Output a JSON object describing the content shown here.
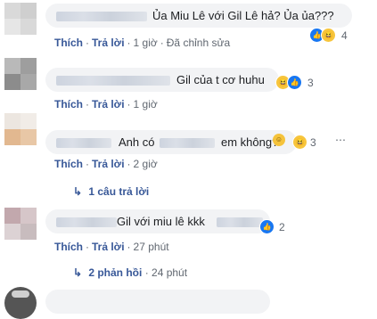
{
  "comments": [
    {
      "text": "Ủa Miu Lê với Gil Lê hả? Ủa ủa???",
      "reaction_count": "4",
      "actions": {
        "like": "Thích",
        "reply": "Trả lời",
        "time": "1 giờ",
        "edited": "Đã chỉnh sửa"
      }
    },
    {
      "text": "Gil của t cơ huhu",
      "reaction_count": "3",
      "actions": {
        "like": "Thích",
        "reply": "Trả lời",
        "time": "1 giờ"
      }
    },
    {
      "text_before": "Anh có",
      "text_after": "em không?",
      "reaction_count": "3",
      "actions": {
        "like": "Thích",
        "reply": "Trả lời",
        "time": "2 giờ"
      },
      "replies_label": "1 câu trả lời"
    },
    {
      "text": "Gil với miu lê kkk",
      "reaction_count": "2",
      "actions": {
        "like": "Thích",
        "reply": "Trả lời",
        "time": "27 phút"
      },
      "replies_label": "2 phản hồi",
      "replies_time": "24 phút"
    }
  ],
  "separator": "·",
  "icons": {
    "like": "like-icon",
    "haha": "haha-icon",
    "reply_arrow": "reply-arrow-icon",
    "emoji": "smiley-emoji-icon"
  },
  "colors": {
    "link": "#385898",
    "bubble": "#f2f3f5",
    "like": "#1877f2",
    "haha": "#f7c53c"
  }
}
